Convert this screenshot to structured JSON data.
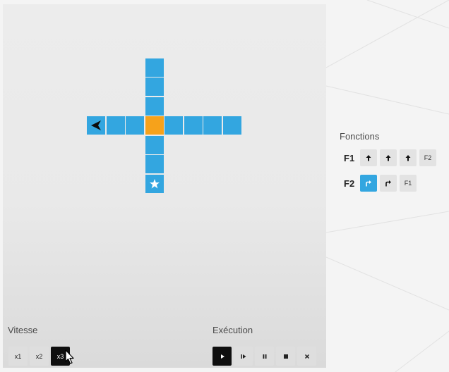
{
  "grid": {
    "current_cell_color": "#f6a21b",
    "cell_color": "#33a6e0",
    "robot_direction": "left",
    "robot_icon": "arrowhead-left-icon",
    "goal_icon": "star-icon"
  },
  "speed": {
    "label": "Vitesse",
    "buttons": [
      {
        "label": "x1",
        "active": false
      },
      {
        "label": "x2",
        "active": false
      },
      {
        "label": "x3",
        "active": true
      }
    ]
  },
  "execution": {
    "label": "Exécution",
    "buttons": [
      {
        "icon": "play-icon",
        "active": true
      },
      {
        "icon": "step-icon",
        "active": false
      },
      {
        "icon": "pause-icon",
        "active": false
      },
      {
        "icon": "stop-icon",
        "active": false
      },
      {
        "icon": "close-icon",
        "active": false
      }
    ]
  },
  "functions": {
    "title": "Fonctions",
    "rows": [
      {
        "label": "F1",
        "slots": [
          "up-arrow-icon",
          "up-arrow-icon",
          "up-arrow-icon",
          "F2"
        ]
      },
      {
        "label": "F2",
        "slots": [
          "turn-right-icon",
          "turn-right-icon",
          "F1"
        ],
        "selected_slot": 0
      }
    ]
  }
}
